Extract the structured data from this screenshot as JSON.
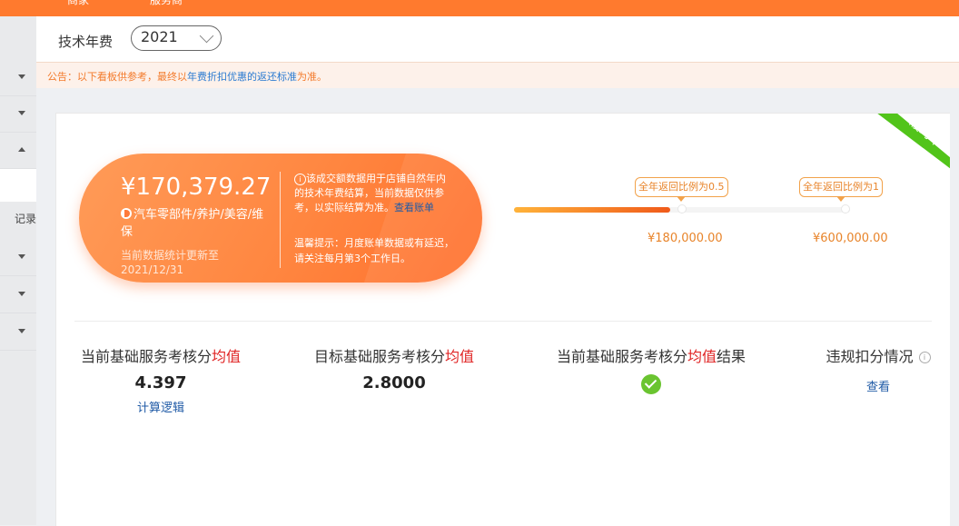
{
  "topbar": {
    "tab_left": "商家",
    "tab_right": "服务商"
  },
  "sidebar": {
    "visible_text": "记录"
  },
  "filter": {
    "label": "技术年费",
    "year": "2021"
  },
  "notice": {
    "prefix": "公告：以下看板供参考，最终以",
    "link": "年费折扣优惠的返还标准",
    "suffix": "为准。"
  },
  "card": {
    "status_badge": "履约中",
    "amount": "¥170,379.27",
    "category": "汽车零部件/养护/美容/维保",
    "update_label": "当前数据统计更新至",
    "update_date": "2021/12/31",
    "info_text": "该成交额数据用于店铺自然年内的技术年费结算，当前数据仅供参考，以实际结算为准。",
    "info_link": "查看账单",
    "tip_text": "温馨提示：月度账单数据或有延迟，请关注每月第3个工作日。",
    "progress": 0.5
  },
  "milestones": [
    {
      "badge": "全年返回比例为0.5",
      "value": "¥180,000.00"
    },
    {
      "badge": "全年返回比例为1",
      "value": "¥600,000.00"
    }
  ],
  "metrics": {
    "current_avg": {
      "label_a": "当前基础服务考核分",
      "label_red": "均值",
      "value": "4.397",
      "link": "计算逻辑"
    },
    "target_avg": {
      "label_a": "目标基础服务考核分",
      "label_red": "均值",
      "value": "2.8000"
    },
    "result": {
      "label_a": "当前基础服务考核分",
      "label_red": "均值",
      "label_b": "结果"
    },
    "violation": {
      "label": "违规扣分情况",
      "link": "查看"
    }
  },
  "colors": {
    "brand": "#ff7a2e",
    "ribbon": "#52c41a",
    "accent_red": "#e02424",
    "link": "#1f5aa6"
  },
  "icons": [
    "chevron-down-icon",
    "chevron-up-icon",
    "category-dot-icon",
    "info-icon",
    "check-circle-icon"
  ]
}
